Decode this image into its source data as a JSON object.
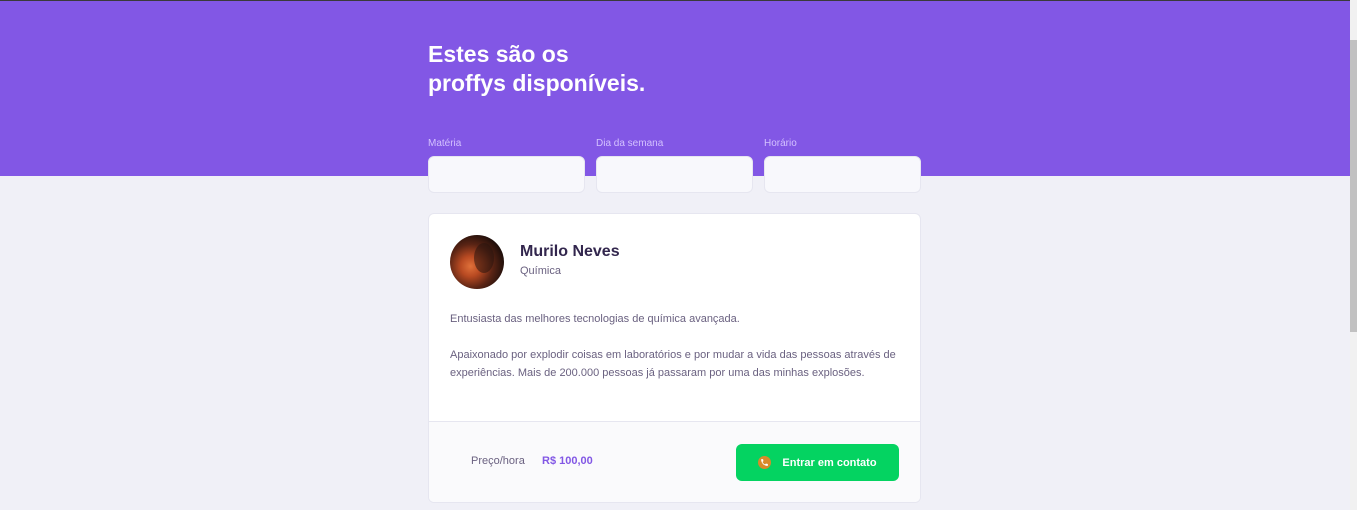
{
  "header": {
    "title_line1": "Estes são os",
    "title_line2": "proffys disponíveis."
  },
  "filters": [
    {
      "label": "Matéria",
      "value": ""
    },
    {
      "label": "Dia da semana",
      "value": ""
    },
    {
      "label": "Horário",
      "value": ""
    }
  ],
  "teacher": {
    "name": "Murilo Neves",
    "subject": "Química",
    "bio_paragraph1": "Entusiasta das melhores tecnologias de química avançada.",
    "bio_paragraph2": "Apaixonado por explodir coisas em laboratórios e por mudar a vida das pessoas através de experiências. Mais de 200.000 pessoas já passaram por uma das minhas explosões.",
    "price_label": "Preço/hora",
    "price_value": "R$ 100,00",
    "contact_label": "Entrar em contato"
  },
  "icons": {
    "contact": "phone-icon"
  },
  "colors": {
    "primary": "#8257e5",
    "secondary": "#04d361",
    "background": "#f0f0f7",
    "title_text": "#32264d",
    "body_text": "#6a6180"
  }
}
